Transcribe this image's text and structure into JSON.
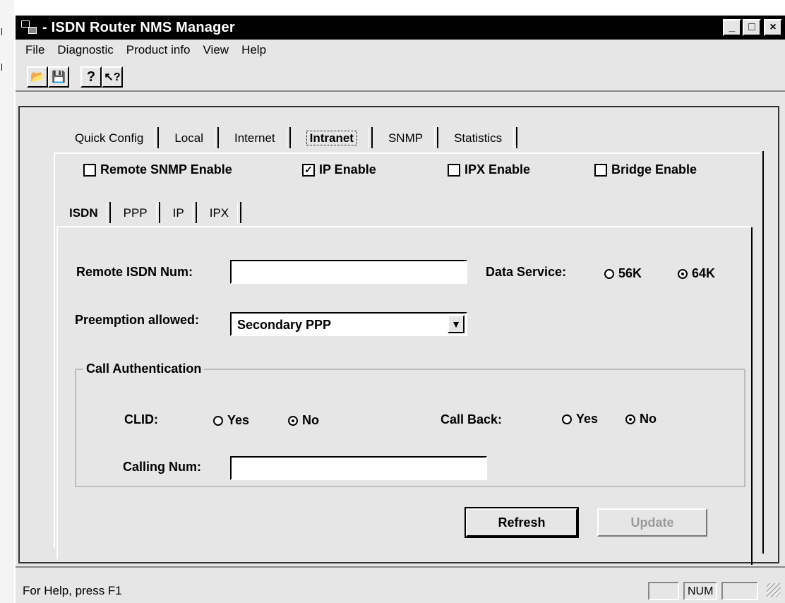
{
  "window": {
    "title": "- ISDN Router NMS Manager"
  },
  "window_controls": {
    "minimize": "_",
    "maximize": "□",
    "close": "×"
  },
  "menu": [
    {
      "label": "File"
    },
    {
      "label": "Diagnostic"
    },
    {
      "label": "Product info"
    },
    {
      "label": "View"
    },
    {
      "label": "Help"
    }
  ],
  "toolbar": {
    "buttons": [
      {
        "icon": "open-folder-icon",
        "glyph": "📂"
      },
      {
        "icon": "save-icon",
        "glyph": "💾"
      },
      {
        "icon": "help-icon",
        "glyph": "?"
      },
      {
        "icon": "context-help-icon",
        "glyph": "↖?"
      }
    ]
  },
  "main_tabs": [
    {
      "label": "Quick Config"
    },
    {
      "label": "Local"
    },
    {
      "label": "Internet"
    },
    {
      "label": "Intranet",
      "active": true
    },
    {
      "label": "SNMP"
    },
    {
      "label": "Statistics"
    }
  ],
  "options": {
    "remote_snmp": {
      "label": "Remote SNMP Enable",
      "checked": false
    },
    "ip": {
      "label": "IP Enable",
      "checked": true
    },
    "ipx": {
      "label": "IPX Enable",
      "checked": false
    },
    "bridge": {
      "label": "Bridge Enable",
      "checked": false
    }
  },
  "sub_tabs": [
    {
      "label": "ISDN",
      "active": true
    },
    {
      "label": "PPP"
    },
    {
      "label": "IP"
    },
    {
      "label": "IPX"
    }
  ],
  "isdn": {
    "remote_num_label": "Remote ISDN Num:",
    "remote_num_value": "",
    "data_service_label": "Data Service:",
    "data_service_options": [
      "56K",
      "64K"
    ],
    "data_service_selected": "64K",
    "preemption_label": "Preemption allowed:",
    "preemption_value": "Secondary PPP"
  },
  "call_auth": {
    "title": "Call Authentication",
    "clid_label": "CLID:",
    "clid_options": [
      "Yes",
      "No"
    ],
    "clid_selected": "No",
    "callback_label": "Call Back:",
    "callback_options": [
      "Yes",
      "No"
    ],
    "callback_selected": "No",
    "calling_num_label": "Calling Num:",
    "calling_num_value": ""
  },
  "buttons": {
    "refresh": "Refresh",
    "update": "Update"
  },
  "status": {
    "text": "For Help, press F1",
    "num": "NUM"
  }
}
